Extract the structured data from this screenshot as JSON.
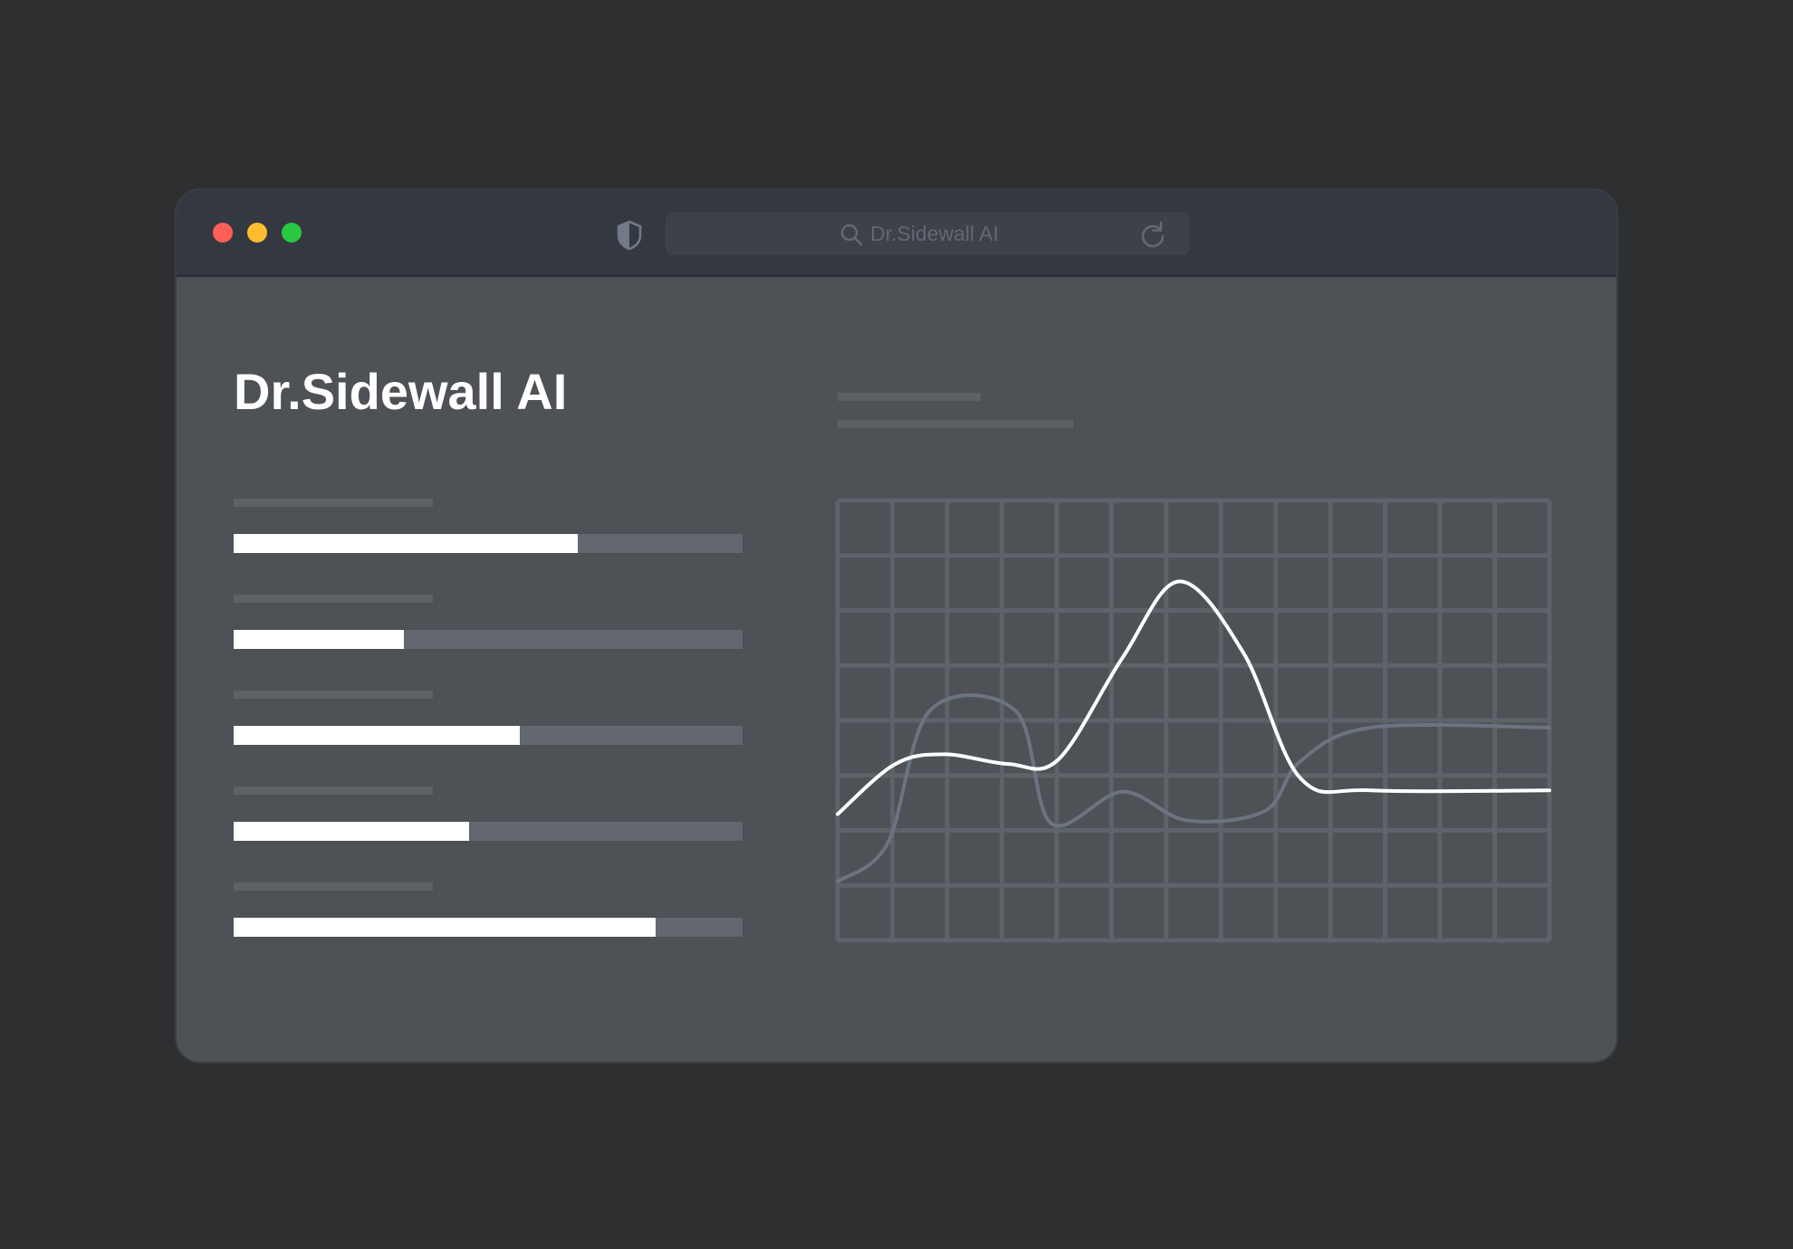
{
  "window": {
    "url_text": "Dr.Sidewall AI",
    "traffic_colors": {
      "close": "#ff5f57",
      "minimize": "#febc2e",
      "maximize": "#28c840"
    }
  },
  "page": {
    "title": "Dr.Sidewall AI"
  },
  "stats": [
    {
      "fill_fraction": 0.677
    },
    {
      "fill_fraction": 0.335
    },
    {
      "fill_fraction": 0.562
    },
    {
      "fill_fraction": 0.462
    },
    {
      "fill_fraction": 0.83
    }
  ],
  "chart_data": {
    "type": "line",
    "grid": true,
    "series": [
      {
        "color": "#ffffff",
        "path": [
          [
            0.0,
            0.713
          ],
          [
            0.08,
            0.6
          ],
          [
            0.15,
            0.577
          ],
          [
            0.24,
            0.599
          ],
          [
            0.31,
            0.589
          ],
          [
            0.4,
            0.358
          ],
          [
            0.48,
            0.184
          ],
          [
            0.57,
            0.346
          ],
          [
            0.65,
            0.631
          ],
          [
            0.75,
            0.659
          ],
          [
            1.0,
            0.659
          ]
        ]
      },
      {
        "color": "#6b7480",
        "path": [
          [
            0.0,
            0.866
          ],
          [
            0.07,
            0.78
          ],
          [
            0.13,
            0.477
          ],
          [
            0.25,
            0.478
          ],
          [
            0.3,
            0.734
          ],
          [
            0.4,
            0.662
          ],
          [
            0.49,
            0.727
          ],
          [
            0.6,
            0.706
          ],
          [
            0.65,
            0.593
          ],
          [
            0.75,
            0.516
          ],
          [
            1.0,
            0.516
          ]
        ]
      }
    ]
  }
}
